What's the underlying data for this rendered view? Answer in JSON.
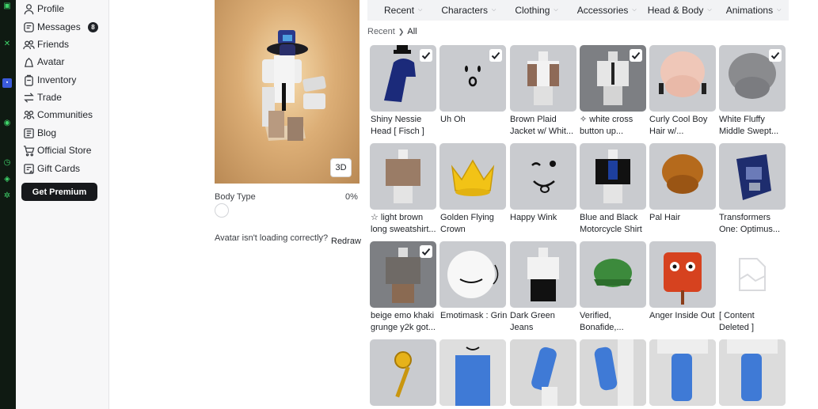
{
  "sidebar": {
    "items": [
      {
        "label": "Profile",
        "icon": "person-icon"
      },
      {
        "label": "Messages",
        "icon": "message-icon"
      },
      {
        "label": "Friends",
        "icon": "friends-icon"
      },
      {
        "label": "Avatar",
        "icon": "avatar-icon"
      },
      {
        "label": "Inventory",
        "icon": "inventory-icon"
      },
      {
        "label": "Trade",
        "icon": "trade-icon"
      },
      {
        "label": "Communities",
        "icon": "communities-icon"
      },
      {
        "label": "Blog",
        "icon": "blog-icon"
      },
      {
        "label": "Official Store",
        "icon": "cart-icon"
      },
      {
        "label": "Gift Cards",
        "icon": "gift-card-icon"
      }
    ],
    "messages_badge": "8",
    "premium_label": "Get Premium"
  },
  "viewer": {
    "mode_label": "3D",
    "body_type_label": "Body Type",
    "body_type_value": "0%",
    "loading_text": "Avatar isn't loading correctly?",
    "redraw_label": "Redraw"
  },
  "tabs": [
    "Recent",
    "Characters",
    "Clothing",
    "Accessories",
    "Head & Body",
    "Animations"
  ],
  "breadcrumb": {
    "parent": "Recent",
    "current": "All"
  },
  "items": [
    {
      "line1": "Shiny Nessie",
      "line2": "Head [ Fisch ]",
      "checked": true
    },
    {
      "line1": "Uh Oh",
      "line2": "",
      "checked": true
    },
    {
      "line1": "Brown Plaid",
      "line2": "Jacket w/ Whit...",
      "checked": false
    },
    {
      "line1": "✧ white cross",
      "line2": "button up...",
      "checked": true
    },
    {
      "line1": "Curly Cool Boy",
      "line2": "Hair w/...",
      "checked": false
    },
    {
      "line1": "White Fluffy",
      "line2": "Middle Swept...",
      "checked": true
    },
    {
      "line1": "☆ light brown",
      "line2": "long sweatshirt...",
      "checked": false
    },
    {
      "line1": "Golden Flying",
      "line2": "Crown",
      "checked": false
    },
    {
      "line1": "Happy Wink",
      "line2": "",
      "checked": false
    },
    {
      "line1": "Blue and Black",
      "line2": "Motorcycle Shirt",
      "checked": false
    },
    {
      "line1": "Pal Hair",
      "line2": "",
      "checked": false
    },
    {
      "line1": "Transformers",
      "line2": "One: Optimus...",
      "checked": false
    },
    {
      "line1": "beige emo khaki",
      "line2": "grunge y2k got...",
      "checked": true
    },
    {
      "line1": "Emotimask : Grin",
      "line2": "",
      "checked": false
    },
    {
      "line1": "Dark Green",
      "line2": "Jeans",
      "checked": false
    },
    {
      "line1": "Verified,",
      "line2": "Bonafide,...",
      "checked": false
    },
    {
      "line1": "Anger Inside Out",
      "line2": "",
      "checked": false
    },
    {
      "line1": "[ Content",
      "line2": "Deleted ]",
      "checked": false
    }
  ],
  "colors": {
    "accent_green": "#3fd46a",
    "premium_bg": "#17191c",
    "tile_bg": "#c9cbcf"
  }
}
